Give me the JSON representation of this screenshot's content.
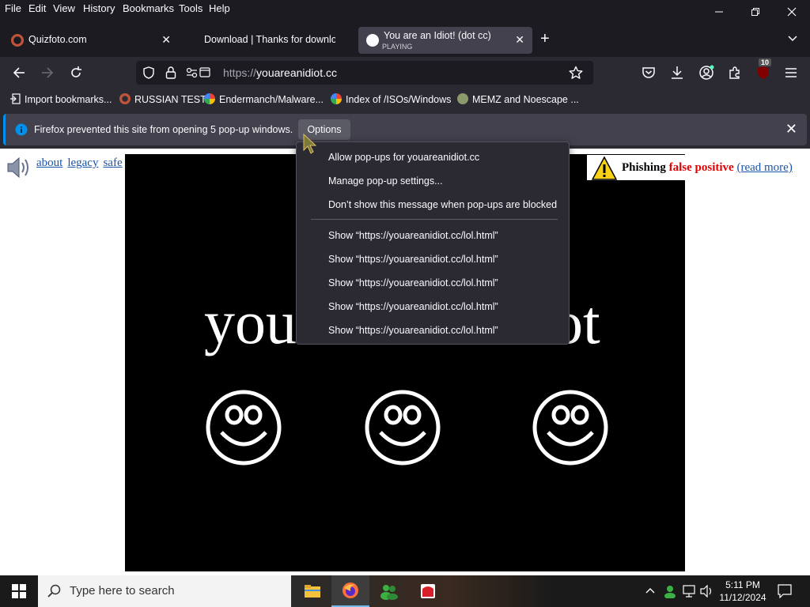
{
  "menubar": {
    "items": [
      "File",
      "Edit",
      "View",
      "History",
      "Bookmarks",
      "Tools",
      "Help"
    ],
    "underline_index": [
      0,
      0,
      0,
      0,
      0,
      0,
      0
    ]
  },
  "tabs": [
    {
      "title": "Quizfoto.com",
      "status": ""
    },
    {
      "title": "Download | Thanks for downloa",
      "status": ""
    },
    {
      "title": "You are an Idiot! (dot cc)",
      "status": "PLAYING"
    }
  ],
  "urlbar": {
    "scheme": "https://",
    "host": "youareanidiot.cc"
  },
  "toolbar": {
    "extensions_badge": "10"
  },
  "bookmarks": [
    {
      "label": "Import bookmarks...",
      "icon": "import-icon"
    },
    {
      "label": "RUSSIAN TEST",
      "icon": "site-icon"
    },
    {
      "label": "Endermanch/Malware...",
      "icon": "google-icon"
    },
    {
      "label": "Index of /ISOs/Windows",
      "icon": "google-icon"
    },
    {
      "label": "MEMZ and Noescape ...",
      "icon": "site-icon"
    }
  ],
  "notification": {
    "text": "Firefox prevented this site from opening 5 pop-up windows.",
    "options_label": "Options"
  },
  "popup_menu": {
    "allow": "Allow pop-ups for youareanidiot.cc",
    "manage": "Manage pop-up settings...",
    "dont_show": "Don’t show this message when pop-ups are blocked",
    "show_items": [
      "Show “https://youareanidiot.cc/lol.html”",
      "Show “https://youareanidiot.cc/lol.html”",
      "Show “https://youareanidiot.cc/lol.html”",
      "Show “https://youareanidiot.cc/lol.html”",
      "Show “https://youareanidiot.cc/lol.html”"
    ]
  },
  "page": {
    "links": [
      "about",
      "legacy",
      "safe"
    ],
    "big_text_left": "you",
    "big_text_right": "ot",
    "phish": {
      "word1": "Phishing",
      "word2": "false positive",
      "link": "(read more)"
    }
  },
  "taskbar": {
    "search_placeholder": "Type here to search",
    "time": "5:11 PM",
    "date": "11/12/2024"
  },
  "colors": {
    "accent": "#0090ed",
    "toolbar": "#2b2a33",
    "frame": "#1c1b22",
    "warning": "#e00000"
  }
}
